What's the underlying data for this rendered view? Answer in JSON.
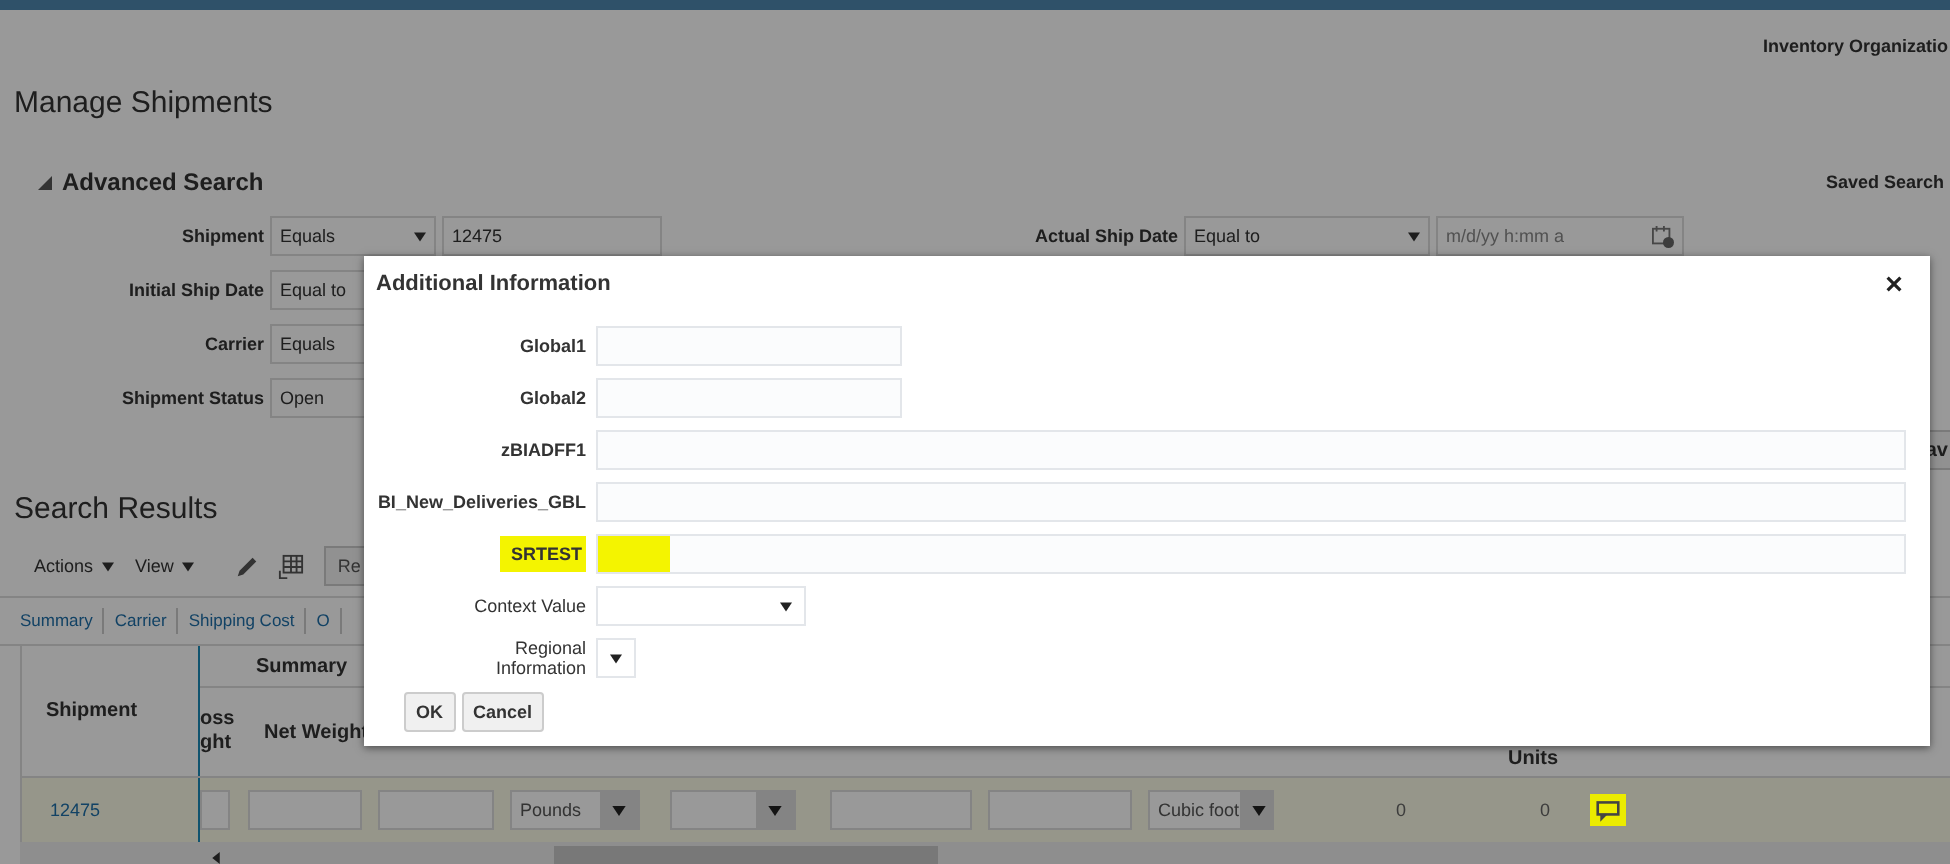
{
  "header": {
    "organization": "Inventory Organizatio"
  },
  "page_title": "Manage Shipments",
  "advanced_search": {
    "title": "Advanced Search",
    "expanded": true,
    "saved_search": "Saved Search",
    "rows": [
      [
        {
          "label": "Shipment",
          "kind": "text",
          "operator": "Equals",
          "value": "12475"
        },
        {
          "label": "Actual Ship Date",
          "kind": "date",
          "operator": "Equal to",
          "placeholder": "m/d/yy h:mm a"
        }
      ],
      [
        {
          "label": "Initial Ship Date",
          "kind": "select",
          "operator": "Equal to"
        }
      ],
      [
        {
          "label": "Carrier",
          "kind": "select",
          "operator": "Equals"
        }
      ],
      [
        {
          "label": "Shipment Status",
          "kind": "select",
          "operator": "Open"
        }
      ]
    ],
    "cut_button": "av"
  },
  "search_results": {
    "title": "Search Results",
    "menus": [
      "Actions",
      "View"
    ],
    "cut_button": "Re",
    "tabs": [
      "Summary",
      "Carrier",
      "Shipping Cost",
      "O"
    ]
  },
  "table": {
    "frozen_header": "Shipment",
    "group_header": "Summary",
    "headers": [
      "oss ght",
      "Net Weight"
    ],
    "units_header": "Units",
    "rows": [
      {
        "shipment": "12475",
        "weight_unit": "Pounds",
        "volume_unit": "Cubic foot",
        "values": [
          "0",
          "0"
        ],
        "highlighted": true
      }
    ]
  },
  "dialog": {
    "title": "Additional Information",
    "fields": [
      {
        "label": "Global1",
        "kind": "short",
        "highlighted": false
      },
      {
        "label": "Global2",
        "kind": "short",
        "highlighted": false
      },
      {
        "label": "zBIADFF1",
        "kind": "wide",
        "highlighted": false
      },
      {
        "label": "BI_New_Deliveries_GBL",
        "kind": "wide",
        "highlighted": false
      },
      {
        "label": "SRTEST",
        "kind": "wide",
        "highlighted": true
      },
      {
        "label": "Context Value",
        "kind": "select",
        "highlighted": false
      },
      {
        "label": "Regional Information",
        "kind": "mini-select",
        "highlighted": false
      }
    ],
    "buttons": [
      "OK",
      "Cancel"
    ]
  }
}
